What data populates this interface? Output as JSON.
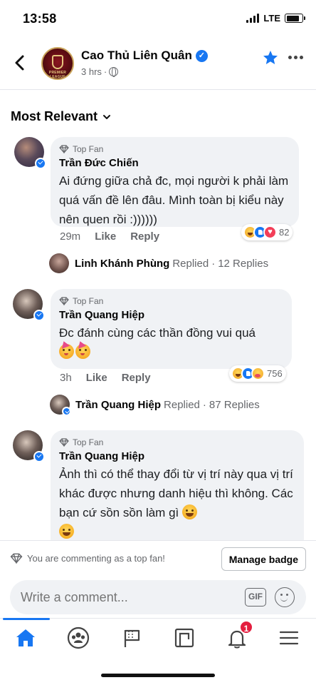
{
  "status": {
    "time": "13:58",
    "network": "LTE",
    "battery_level": 0.85
  },
  "header": {
    "page_name": "Cao Thủ Liên Quân",
    "time_ago": "3 hrs",
    "separator": "·",
    "logo_text": "PREMIER LEAGUE"
  },
  "sort": {
    "label": "Most Relevant"
  },
  "comments": [
    {
      "badge": "Top Fan",
      "author": "Trần Đức Chiến",
      "text": "Ai đứng giữa chả đc, mọi người k phải làm quá vấn đề lên đâu. Mình toàn bị kiểu này nên quen rồi :))))))",
      "time": "29m",
      "like": "Like",
      "reply": "Reply",
      "reaction_count": "82",
      "reactions": [
        "haha",
        "like",
        "love"
      ],
      "replies": {
        "name": "Linh Khánh Phùng",
        "replied": "Replied",
        "separator": "·",
        "count": "12 Replies"
      }
    },
    {
      "badge": "Top Fan",
      "author": "Trần Quang Hiệp",
      "text": "Đc đánh cùng các thần đồng vui quá",
      "emojis": [
        "partying-face",
        "partying-face"
      ],
      "time": "3h",
      "like": "Like",
      "reply": "Reply",
      "reaction_count": "756",
      "reactions": [
        "haha",
        "like",
        "care"
      ],
      "replies": {
        "name": "Trần Quang Hiệp",
        "replied": "Replied",
        "separator": "·",
        "count": "87 Replies"
      }
    },
    {
      "badge": "Top Fan",
      "author": "Trần Quang Hiệp",
      "text": "Ảnh thì có thể thay đổi từ vị trí này qua vị trí khác được nhưng danh hiệu thì không. Các bạn cứ sồn sồn làm gì",
      "emojis": [
        "laughing-face",
        "laughing-face"
      ]
    }
  ],
  "fan_bar": {
    "text": "You are commenting as a top fan!",
    "button": "Manage badge"
  },
  "composer": {
    "placeholder": "Write a comment...",
    "gif_label": "GIF"
  },
  "tabs": {
    "notifications_count": "1"
  },
  "colors": {
    "accent": "#1877f2",
    "bubble": "#f0f2f5",
    "secondary_text": "#65676b",
    "notification": "#e41e3f"
  }
}
